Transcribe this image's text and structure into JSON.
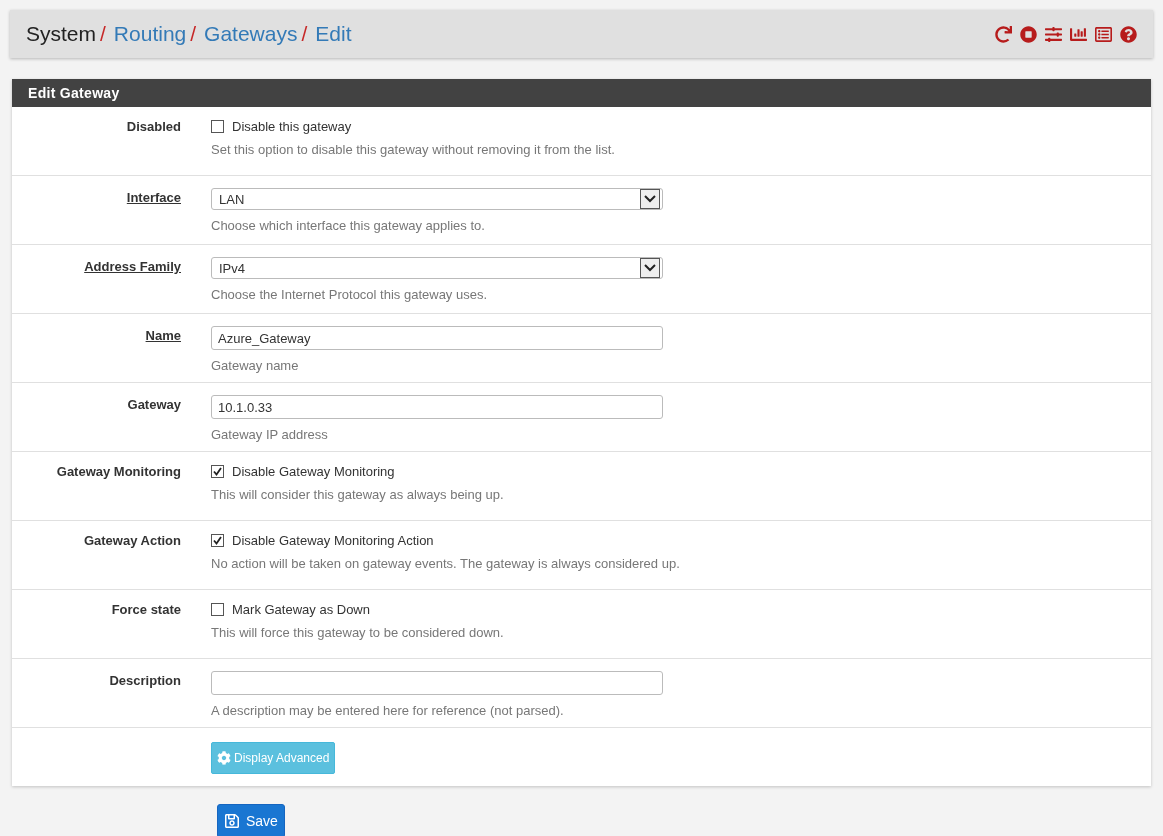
{
  "breadcrumb": [
    {
      "label": "System",
      "link": false,
      "separator": "/"
    },
    {
      "label": "Routing",
      "link": true,
      "separator": "/"
    },
    {
      "label": "Gateways",
      "link": true,
      "separator": "/"
    },
    {
      "label": "Edit",
      "link": true
    }
  ],
  "panel": {
    "title": "Edit Gateway"
  },
  "rows": [
    {
      "kind": "checkbox",
      "label": "Disabled",
      "required": false,
      "option": "Disable this gateway",
      "checked": false,
      "help": "Set this option to disable this gateway without removing it from the list."
    },
    {
      "kind": "select",
      "label": "Interface",
      "required": true,
      "value": "LAN",
      "help": "Choose which interface this gateway applies to."
    },
    {
      "kind": "select",
      "label": "Address Family",
      "required": true,
      "value": "IPv4",
      "help": "Choose the Internet Protocol this gateway uses."
    },
    {
      "kind": "text",
      "label": "Name",
      "required": true,
      "value": "Azure_Gateway",
      "help": "Gateway name"
    },
    {
      "kind": "text",
      "label": "Gateway",
      "required": false,
      "value": "10.1.0.33",
      "help": "Gateway IP address"
    },
    {
      "kind": "checkbox",
      "label": "Gateway Monitoring",
      "required": false,
      "option": "Disable Gateway Monitoring",
      "checked": true,
      "help": "This will consider this gateway as always being up."
    },
    {
      "kind": "checkbox",
      "label": "Gateway Action",
      "required": false,
      "option": "Disable Gateway Monitoring Action",
      "checked": true,
      "help": "No action will be taken on gateway events. The gateway is always considered up."
    },
    {
      "kind": "checkbox",
      "label": "Force state",
      "required": false,
      "option": "Mark Gateway as Down",
      "checked": false,
      "help": "This will force this gateway to be considered down."
    },
    {
      "kind": "text",
      "label": "Description",
      "required": false,
      "value": "",
      "help": "A description may be entered here for reference (not parsed)."
    }
  ],
  "advanced_button": "Display Advanced",
  "save_button": "Save"
}
